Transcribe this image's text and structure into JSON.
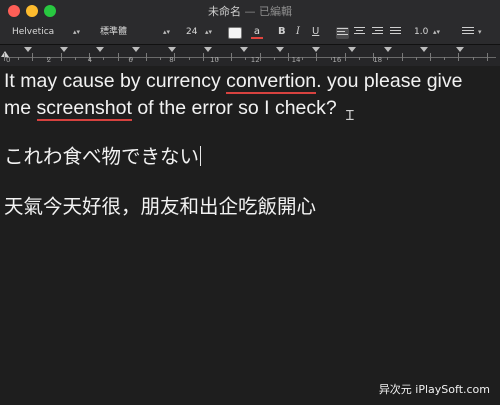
{
  "window": {
    "title": "未命名",
    "separator": "—",
    "status": "已編輯"
  },
  "toolbar": {
    "font_family": "Helvetica",
    "font_style": "標準體",
    "font_size": "24",
    "bold_label": "B",
    "italic_label": "I",
    "underline_label": "U",
    "line_spacing": "1.0",
    "text_color": "#f5f5f5",
    "highlight_glyph": "a"
  },
  "ruler": {
    "labels": [
      "0",
      "2",
      "4",
      "6",
      "8",
      "10",
      "12",
      "14",
      "16",
      "18"
    ]
  },
  "document": {
    "line1_a": "It may cause by currency ",
    "line1_misspelled": "convertion",
    "line1_b": ". you please give",
    "line2_a": "me ",
    "line2_misspelled": "screenshot",
    "line2_b": " of the error so I check?",
    "para2": "これわ食べ物できない",
    "para3": "天氣今天好很，朋友和出企吃飯開心"
  },
  "watermark": "异次元 iPlaySoft.com",
  "colors": {
    "spell_underline": "#d7423f",
    "background": "#1e1e1e",
    "text": "#f2f2f2"
  }
}
